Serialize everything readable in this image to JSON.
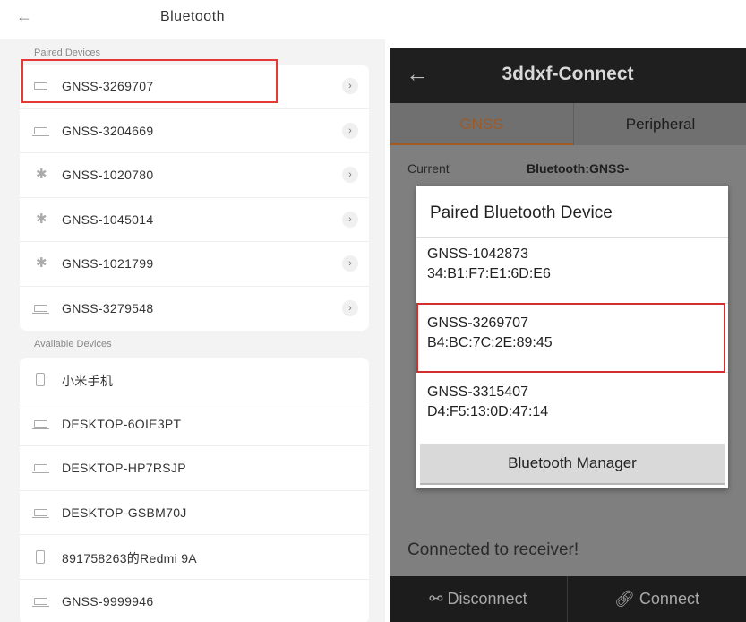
{
  "left": {
    "title": "Bluetooth",
    "paired_header": "Paired Devices",
    "available_header": "Available Devices",
    "paired": [
      {
        "name": "GNSS-3269707",
        "icon": "laptop-icon"
      },
      {
        "name": "GNSS-3204669",
        "icon": "laptop-icon"
      },
      {
        "name": "GNSS-1020780",
        "icon": "bluetooth-icon"
      },
      {
        "name": "GNSS-1045014",
        "icon": "bluetooth-icon"
      },
      {
        "name": "GNSS-1021799",
        "icon": "bluetooth-icon"
      },
      {
        "name": "GNSS-3279548",
        "icon": "laptop-icon"
      }
    ],
    "available": [
      {
        "name": "小米手机",
        "icon": "phone-icon"
      },
      {
        "name": "DESKTOP-6OIE3PT",
        "icon": "laptop-icon"
      },
      {
        "name": "DESKTOP-HP7RSJP",
        "icon": "laptop-icon"
      },
      {
        "name": "DESKTOP-GSBM70J",
        "icon": "laptop-icon"
      },
      {
        "name": "891758263的Redmi 9A",
        "icon": "phone-icon"
      },
      {
        "name": "GNSS-9999946",
        "icon": "laptop-icon"
      }
    ]
  },
  "right": {
    "title": "3ddxf-Connect",
    "tabs": [
      "GNSS",
      "Peripheral"
    ],
    "current_label": "Current",
    "current_value": "Bluetooth:GNSS-",
    "status": "Connected to receiver!",
    "disconnect": "Disconnect",
    "connect": "Connect",
    "dialog": {
      "title": "Paired Bluetooth Device",
      "items": [
        {
          "name": "GNSS-1042873",
          "mac": "34:B1:F7:E1:6D:E6"
        },
        {
          "name": "GNSS-3269707",
          "mac": "B4:BC:7C:2E:89:45"
        },
        {
          "name": "GNSS-3315407",
          "mac": "D4:F5:13:0D:47:14"
        }
      ],
      "manager_button": "Bluetooth Manager"
    }
  },
  "colors": {
    "highlight": "#e53935",
    "tab_accent": "#a15a22"
  }
}
